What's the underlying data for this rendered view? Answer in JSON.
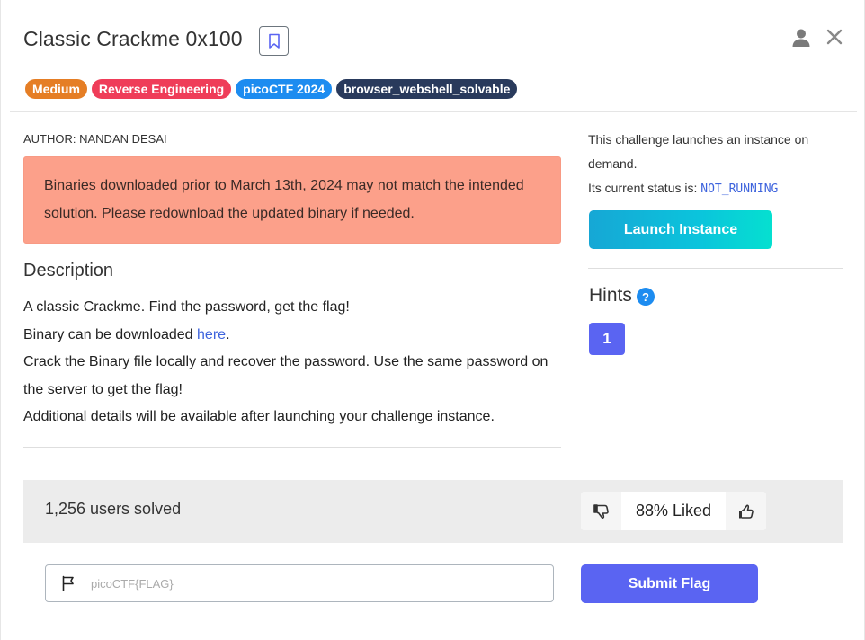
{
  "header": {
    "title": "Classic Crackme 0x100",
    "bookmark_icon": "bookmark-icon",
    "user_icon": "user-icon",
    "close_icon": "close-icon"
  },
  "tags": [
    {
      "label": "Medium",
      "color": "#e57e25"
    },
    {
      "label": "Reverse Engineering",
      "color": "#ef3d59"
    },
    {
      "label": "picoCTF 2024",
      "color": "#1d8cf0"
    },
    {
      "label": "browser_webshell_solvable",
      "color": "#293a5c"
    }
  ],
  "main": {
    "author": "AUTHOR: NANDAN DESAI",
    "alert": "Binaries downloaded prior to March 13th, 2024 may not match the intended solution. Please redownload the updated binary if needed.",
    "description_heading": "Description",
    "description": {
      "line1": "A classic Crackme. Find the password, get the flag!",
      "line2_prefix": "Binary can be downloaded ",
      "line2_link": "here",
      "line2_suffix": ".",
      "line3": "Crack the Binary file locally and recover the password. Use the same password on the server to get the flag!",
      "line4": "Additional details will be available after launching your challenge instance."
    }
  },
  "instance": {
    "text": "This challenge launches an instance on demand.",
    "status_prefix": "Its current status is: ",
    "status_value": "NOT_RUNNING",
    "launch_label": "Launch Instance"
  },
  "hints": {
    "heading": "Hints",
    "help_glyph": "?",
    "items": [
      "1"
    ]
  },
  "stats": {
    "solved": "1,256 users solved",
    "liked": "88% Liked",
    "thumbs_down_icon": "thumbs-down-icon",
    "thumbs_up_icon": "thumbs-up-icon"
  },
  "flag": {
    "placeholder": "picoCTF{FLAG}",
    "value": "",
    "submit_label": "Submit Flag",
    "flag_icon": "flag-icon"
  },
  "colors": {
    "accent": "#5a64f2",
    "alert_bg": "#fca08a",
    "link": "#3d63dd"
  }
}
